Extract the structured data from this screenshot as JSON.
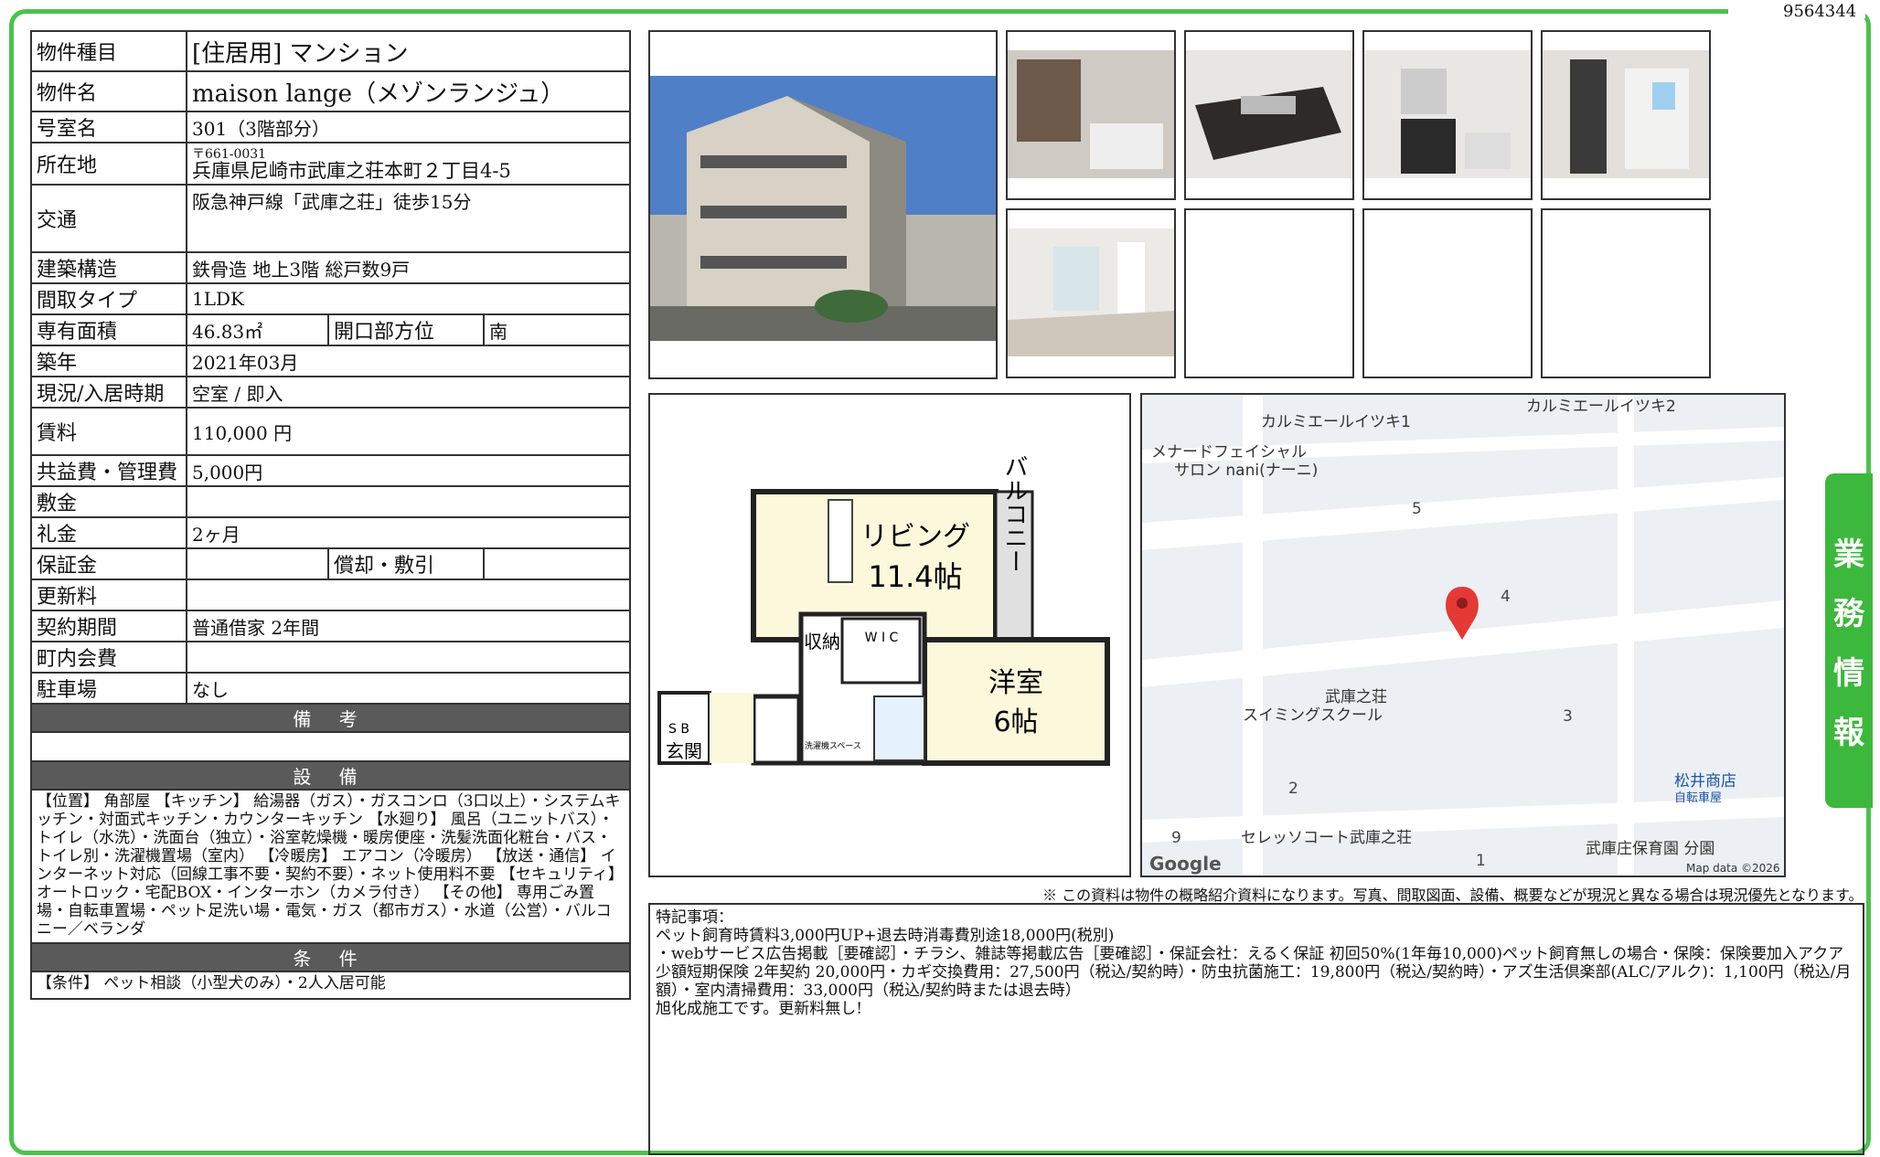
{
  "doc_id": "9564344",
  "side_tab": [
    "業",
    "務",
    "情",
    "報"
  ],
  "spec": {
    "type_label": "物件種目",
    "type_value": "[住居用] マンション",
    "name_label": "物件名",
    "name_value": "maison lange（メゾンランジュ）",
    "room_label": "号室名",
    "room_value": "301（3階部分）",
    "addr_label": "所在地",
    "addr_zip": "〒661-0031",
    "addr_value": "兵庫県尼崎市武庫之荘本町２丁目4-5",
    "traffic_label": "交通",
    "traffic_value": "阪急神戸線「武庫之荘」徒歩15分",
    "structure_label": "建築構造",
    "structure_value": "鉄骨造 地上3階 総戸数9戸",
    "layout_label": "間取タイプ",
    "layout_value": "1LDK",
    "area_label": "専有面積",
    "area_value": "46.83㎡",
    "dir_label": "開口部方位",
    "dir_value": "南",
    "built_label": "築年",
    "built_value": "2021年03月",
    "status_label": "現況/入居時期",
    "status_value": "空室 / 即入",
    "rent_label": "賃料",
    "rent_value": "110,000 円",
    "fee_label": "共益費・管理費",
    "fee_value": "5,000円",
    "deposit_label": "敷金",
    "deposit_value": "",
    "key_label": "礼金",
    "key_value": "2ヶ月",
    "guarantee_label": "保証金",
    "guarantee_value": "",
    "refund_label": "償却・敷引",
    "refund_value": "",
    "renew_label": "更新料",
    "renew_value": "",
    "contract_label": "契約期間",
    "contract_value": "普通借家 2年間",
    "town_label": "町内会費",
    "town_value": "",
    "parking_label": "駐車場",
    "parking_value": "なし",
    "remarks_title": "備 考",
    "remarks_value": "",
    "equip_title": "設 備",
    "equip_value": "【位置】 角部屋 【キッチン】 給湯器（ガス）・ガスコンロ（3口以上）・システムキッチン・対面式キッチン・カウンターキッチン 【水廻り】 風呂（ユニットバス）・トイレ（水洗）・洗面台（独立）・浴室乾燥機・暖房便座・洗髪洗面化粧台・バス・トイレ別・洗濯機置場（室内） 【冷暖房】 エアコン（冷暖房） 【放送・通信】 インターネット対応（回線工事不要・契約不要）・ネット使用料不要 【セキュリティ】 オートロック・宅配BOX・インターホン（カメラ付き） 【その他】 専用ごみ置場・自転車置場・ペット足洗い場・電気・ガス（都市ガス）・水道（公営）・バルコニー／ベランダ",
    "cond_title": "条 件",
    "cond_value": "【条件】 ペット相談（小型犬のみ）・2人入居可能"
  },
  "plan": {
    "living": "リビング",
    "living_size": "11.4帖",
    "balcony": "バルコニー",
    "western": "洋室",
    "western_size": "6帖",
    "storage": "収納",
    "wic": "W I C",
    "sb": "S B",
    "entrance": "玄関",
    "washer": "洗濯機スペース"
  },
  "map": {
    "labels": [
      "カルミエールイツキ1",
      "カルミエールイツキ2",
      "メナードフェイシャル",
      "サロン nani(ナーニ)",
      "武庫之荘",
      "スイミングスクール",
      "松井商店",
      "自転車屋",
      "セレッソコート武庫之荘",
      "武庫庄保育園 分園",
      "Google",
      "Map data ©2026"
    ],
    "numbers": [
      "5",
      "4",
      "3",
      "2",
      "1",
      "9"
    ],
    "pin_color": "#e53935"
  },
  "disclaimer": "※ この資料は物件の概略紹介資料になります。写真、間取図面、設備、概要などが現況と異なる場合は現況優先となります。",
  "special": {
    "title": "特記事項：",
    "lines": [
      "ペット飼育時賃料3,000円UP+退去時消毒費別途18,000円(税別)",
      "・webサービス広告掲載［要確認］・チラシ、雑誌等掲載広告［要確認］・保証会社：えるく保証 初回50%(1年毎10,000)ペット飼育無しの場合・保険：保険要加入アクア少額短期保険 2年契約 20,000円・カギ交換費用：27,500円（税込/契約時）・防虫抗菌施工：19,800円（税込/契約時）・アズ生活倶楽部(ALC/アルク)：1,100円（税込/月額）・室内清掃費用：33,000円（税込/契約時または退去時）",
      "旭化成施工です。更新料無し!"
    ]
  }
}
